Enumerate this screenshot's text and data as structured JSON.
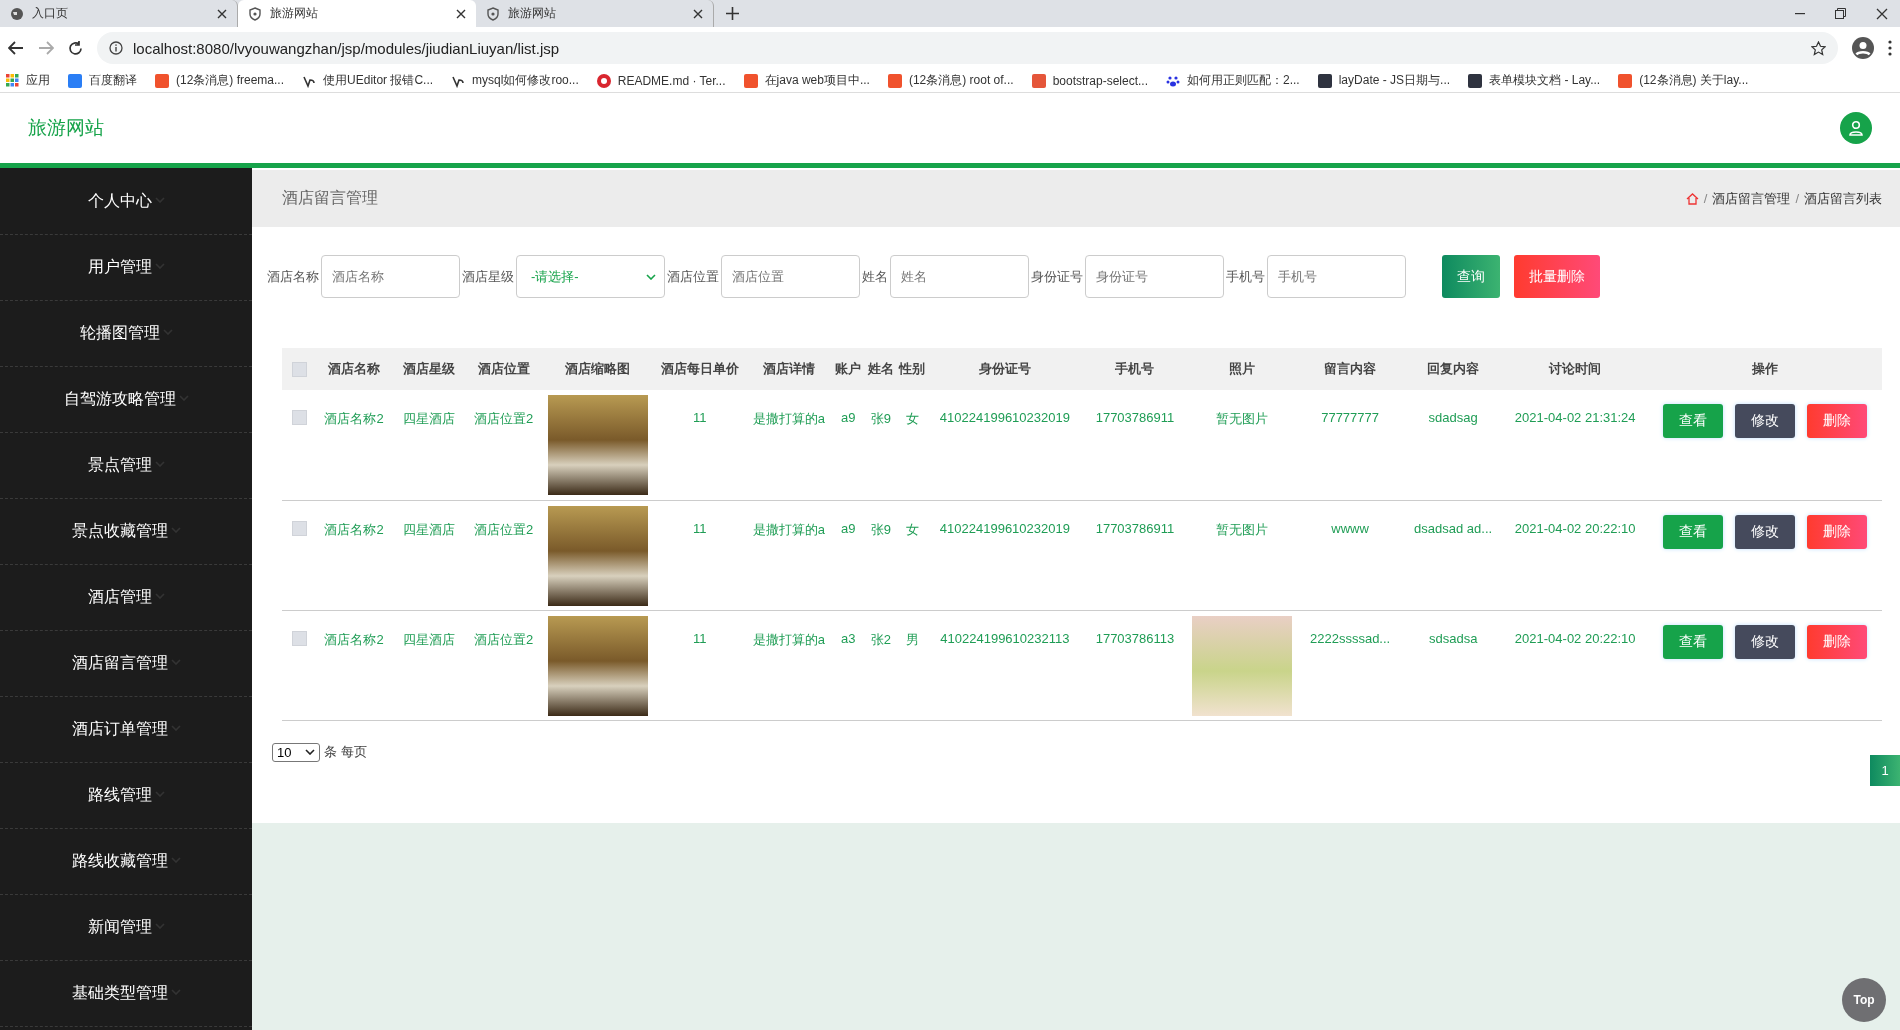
{
  "browser": {
    "tabs": [
      {
        "title": "入口页",
        "kind": "globe",
        "selected": false
      },
      {
        "title": "旅游网站",
        "kind": "shield",
        "selected": true
      },
      {
        "title": "旅游网站",
        "kind": "shield",
        "selected": false
      }
    ],
    "url": "localhost:8080/lvyouwangzhan/jsp/modules/jiudianLiuyan/list.jsp",
    "bookmarks": [
      {
        "label": "应用",
        "kind": "apps"
      },
      {
        "label": "百度翻译",
        "kind": "square",
        "color": "#2a7ef5"
      },
      {
        "label": "(12条消息) freema...",
        "kind": "square",
        "color": "#f0522d"
      },
      {
        "label": "使用UEditor 报错C...",
        "kind": "swirl"
      },
      {
        "label": "mysql如何修改roo...",
        "kind": "swirl"
      },
      {
        "label": "README.md · Ter...",
        "kind": "circle",
        "color": "#d9262f"
      },
      {
        "label": "在java web项目中...",
        "kind": "square",
        "color": "#f0522d"
      },
      {
        "label": "(12条消息) root of...",
        "kind": "square",
        "color": "#f0522d"
      },
      {
        "label": "bootstrap-select...",
        "kind": "square",
        "color": "#e5563a"
      },
      {
        "label": "如何用正则匹配：2...",
        "kind": "paw"
      },
      {
        "label": "layDate - JS日期与...",
        "kind": "square",
        "color": "#2f3340"
      },
      {
        "label": "表单模块文档 - Lay...",
        "kind": "square",
        "color": "#2f3340"
      },
      {
        "label": "(12条消息) 关于lay...",
        "kind": "square",
        "color": "#f0522d"
      }
    ]
  },
  "app": {
    "title": "旅游网站"
  },
  "sidebar": {
    "items": [
      "个人中心",
      "用户管理",
      "轮播图管理",
      "自驾游攻略管理",
      "景点管理",
      "景点收藏管理",
      "酒店管理",
      "酒店留言管理",
      "酒店订单管理",
      "路线管理",
      "路线收藏管理",
      "新闻管理",
      "基础类型管理"
    ]
  },
  "page_title": "酒店留言管理",
  "breadcrumb": [
    "酒店留言管理",
    "酒店留言列表"
  ],
  "breadcrumb_separator": "/",
  "search": {
    "fields": [
      {
        "label": "酒店名称",
        "kind": "input",
        "placeholder": "酒店名称"
      },
      {
        "label": "酒店星级",
        "kind": "select",
        "value": "-请选择-"
      },
      {
        "label": "酒店位置",
        "kind": "input",
        "placeholder": "酒店位置"
      },
      {
        "label": "姓名",
        "kind": "input",
        "placeholder": "姓名"
      },
      {
        "label": "身份证号",
        "kind": "input",
        "placeholder": "身份证号"
      },
      {
        "label": "手机号",
        "kind": "input",
        "placeholder": "手机号"
      }
    ],
    "buttons": [
      {
        "label": "查询",
        "kind": "query"
      },
      {
        "label": "批量删除",
        "kind": "danger"
      }
    ]
  },
  "table": {
    "all_checked": false,
    "columns": [
      "酒店名称",
      "酒店星级",
      "酒店位置",
      "酒店缩略图",
      "酒店每日单价",
      "酒店详情",
      "账户",
      "姓名",
      "性别",
      "身份证号",
      "手机号",
      "照片",
      "留言内容",
      "回复内容",
      "讨论时间",
      "操作"
    ],
    "rows": [
      {
        "checked": false,
        "name": "酒店名称2",
        "star": "四星酒店",
        "location": "酒店位置2",
        "price": "11",
        "details": "是撒打算的a",
        "account": "a9",
        "person": "张9",
        "gender": "女",
        "id_number": "410224199610232019",
        "phone": "17703786911",
        "photo": {
          "kind": "text",
          "text": "暂无图片"
        },
        "message": "77777777",
        "reply": "sdadsag",
        "time": "2021-04-02 21:31:24",
        "actions": [
          {
            "label": "查看",
            "kind": "view"
          },
          {
            "label": "修改",
            "kind": "edit"
          },
          {
            "label": "删除",
            "kind": "delete"
          }
        ]
      },
      {
        "checked": false,
        "name": "酒店名称2",
        "star": "四星酒店",
        "location": "酒店位置2",
        "price": "11",
        "details": "是撒打算的a",
        "account": "a9",
        "person": "张9",
        "gender": "女",
        "id_number": "410224199610232019",
        "phone": "17703786911",
        "photo": {
          "kind": "text",
          "text": "暂无图片"
        },
        "message": "wwww",
        "reply": "dsadsad ad...",
        "time": "2021-04-02 20:22:10",
        "actions": [
          {
            "label": "查看",
            "kind": "view"
          },
          {
            "label": "修改",
            "kind": "edit"
          },
          {
            "label": "删除",
            "kind": "delete"
          }
        ]
      },
      {
        "checked": false,
        "name": "酒店名称2",
        "star": "四星酒店",
        "location": "酒店位置2",
        "price": "11",
        "details": "是撒打算的a",
        "account": "a3",
        "person": "张2",
        "gender": "男",
        "id_number": "410224199610232113",
        "phone": "17703786113",
        "photo": {
          "kind": "image"
        },
        "message": "2222ssssad...",
        "reply": "sdsadsa",
        "time": "2021-04-02 20:22:10",
        "actions": [
          {
            "label": "查看",
            "kind": "view"
          },
          {
            "label": "修改",
            "kind": "edit"
          },
          {
            "label": "删除",
            "kind": "delete"
          }
        ]
      }
    ]
  },
  "pagination": {
    "page_size": "10",
    "page_size_label": "条 每页",
    "pages": [
      {
        "label": "1",
        "selected": true
      }
    ]
  },
  "back_to_top": "Top"
}
